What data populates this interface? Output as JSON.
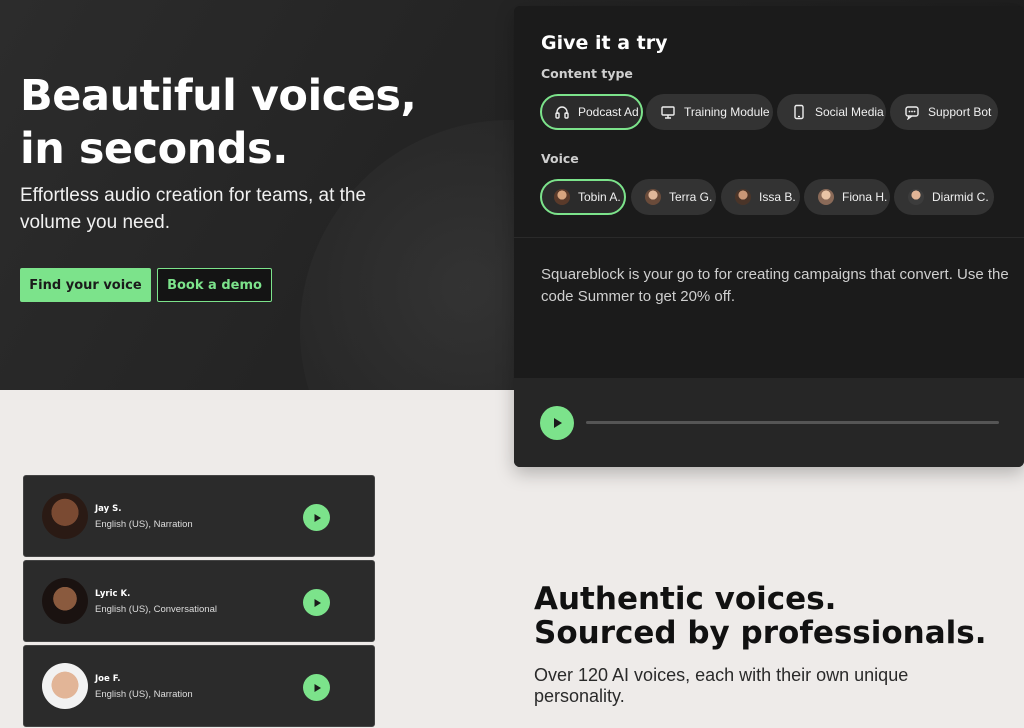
{
  "hero": {
    "title_line1": "Beautiful voices,",
    "title_line2": "in seconds.",
    "subtitle": "Effortless audio creation for teams, at the volume you need.",
    "primary_button": "Find your voice",
    "secondary_button": "Book a demo"
  },
  "try_panel": {
    "title": "Give it a try",
    "content_type_label": "Content type",
    "content_types": [
      {
        "label": "Podcast Ad",
        "icon": "headphones-icon",
        "selected": true
      },
      {
        "label": "Training Module",
        "icon": "presentation-icon",
        "selected": false
      },
      {
        "label": "Social Media",
        "icon": "phone-icon",
        "selected": false
      },
      {
        "label": "Support Bot",
        "icon": "chat-icon",
        "selected": false
      }
    ],
    "voice_label": "Voice",
    "voices": [
      {
        "label": "Tobin A.",
        "selected": true
      },
      {
        "label": "Terra G.",
        "selected": false
      },
      {
        "label": "Issa B.",
        "selected": false
      },
      {
        "label": "Fiona H.",
        "selected": false
      },
      {
        "label": "Diarmid C.",
        "selected": false
      }
    ],
    "script_text": "Squareblock is your go to for creating campaigns that convert. Use the code Summer to get 20% off.",
    "play_icon": "play-icon"
  },
  "voice_cards": [
    {
      "name": "Jay S.",
      "meta": "English (US), Narration"
    },
    {
      "name": "Lyric K.",
      "meta": "English (US), Conversational"
    },
    {
      "name": "Joe F.",
      "meta": "English (US), Narration"
    }
  ],
  "authentic": {
    "title_line1": "Authentic voices.",
    "title_line2": "Sourced by professionals.",
    "subtitle": "Over 120 AI voices, each with their own unique personality."
  },
  "colors": {
    "accent": "#7ce38b",
    "dark": "#1b1b1b",
    "light_bg": "#eeebe9"
  }
}
